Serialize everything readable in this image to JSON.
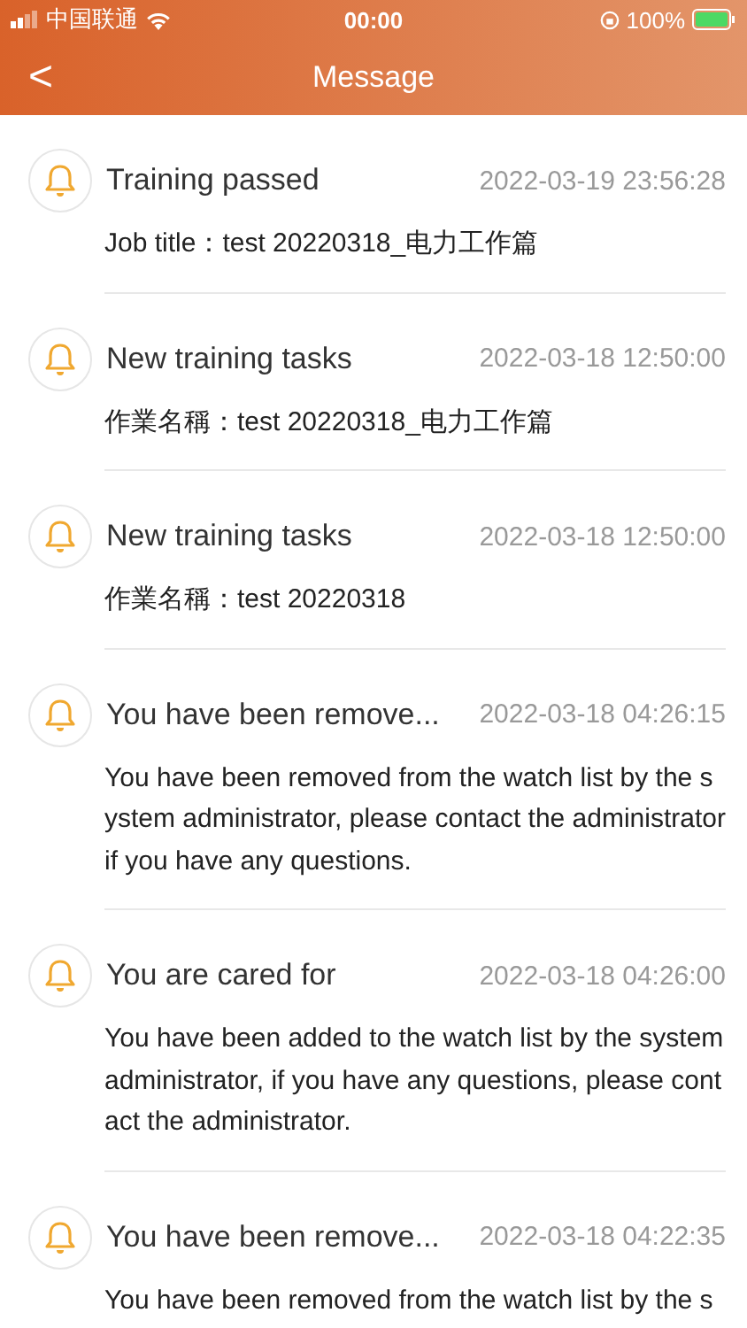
{
  "status_bar": {
    "carrier": "中国联通",
    "time": "00:00",
    "battery": "100%",
    "charging": true
  },
  "nav": {
    "back": "<",
    "title": "Message"
  },
  "messages": [
    {
      "title": "Training passed",
      "time": "2022-03-19 23:56:28",
      "body": "Job title：test 20220318_电力工作篇"
    },
    {
      "title": "New training tasks",
      "time": "2022-03-18 12:50:00",
      "body": "作業名稱：test 20220318_电力工作篇"
    },
    {
      "title": "New training tasks",
      "time": "2022-03-18 12:50:00",
      "body": "作業名稱：test 20220318"
    },
    {
      "title": "You have been remove...",
      "time": "2022-03-18 04:26:15",
      "body": "You have been removed from the watch list by the system administrator, please contact the administrator if you have any questions."
    },
    {
      "title": "You are cared for",
      "time": "2022-03-18 04:26:00",
      "body": "You have been added to the watch list by the system administrator, if you have any questions, please contact the administrator."
    },
    {
      "title": "You have been remove...",
      "time": "2022-03-18 04:22:35",
      "body": "You have been removed from the watch list by the s"
    }
  ]
}
